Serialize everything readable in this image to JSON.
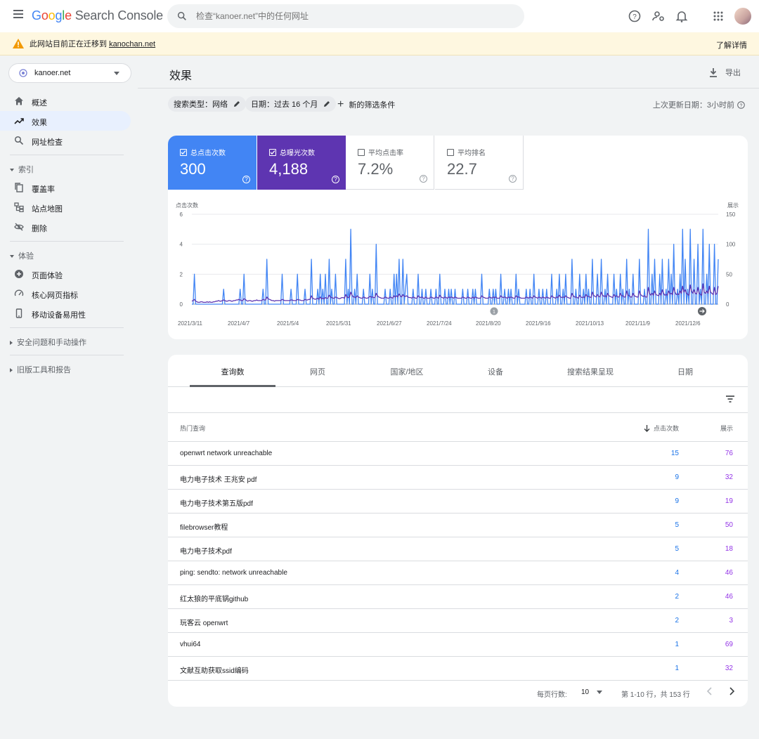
{
  "app": {
    "title_parts": [
      "G",
      "o",
      "o",
      "g",
      "l",
      "e"
    ],
    "product": "Search Console"
  },
  "search": {
    "placeholder": "检查“kanoer.net”中的任何网址"
  },
  "banner": {
    "message": "此网站目前正在迁移到 ",
    "link": "kanochan.net",
    "action": "了解详情"
  },
  "property": {
    "name": "kanoer.net"
  },
  "sidebar": {
    "items": [
      {
        "label": "概述",
        "icon": "home-icon"
      },
      {
        "label": "效果",
        "icon": "trending-up-icon"
      },
      {
        "label": "网址检查",
        "icon": "search-icon"
      }
    ],
    "sections": [
      {
        "label": "索引",
        "items": [
          {
            "label": "覆盖率",
            "icon": "copy-icon"
          },
          {
            "label": "站点地图",
            "icon": "sitemap-icon"
          },
          {
            "label": "删除",
            "icon": "eye-off-icon"
          }
        ]
      },
      {
        "label": "体验",
        "items": [
          {
            "label": "页面体验",
            "icon": "plus-circle-icon"
          },
          {
            "label": "核心网页指标",
            "icon": "gauge-icon"
          },
          {
            "label": "移动设备易用性",
            "icon": "phone-icon"
          }
        ]
      },
      {
        "label": "安全问题和手动操作"
      },
      {
        "label": "旧版工具和报告"
      }
    ]
  },
  "header": {
    "title": "效果",
    "export_label": "导出"
  },
  "filters": {
    "search_type": "搜索类型：网络",
    "date": "日期：过去 16 个月",
    "add": "新的筛选条件",
    "updated": "上次更新日期：3小时前"
  },
  "metrics": [
    {
      "label": "总点击次数",
      "value": "300",
      "checked": true,
      "color": "#4285f4"
    },
    {
      "label": "总曝光次数",
      "value": "4,188",
      "checked": true,
      "color": "#5e35b1"
    },
    {
      "label": "平均点击率",
      "value": "7.2%",
      "checked": false,
      "color": "#ffffff"
    },
    {
      "label": "平均排名",
      "value": "22.7",
      "checked": false,
      "color": "#ffffff"
    }
  ],
  "chart_data": {
    "type": "line",
    "left_axis_label": "点击次数",
    "right_axis_label": "展示",
    "left_ticks": [
      0,
      2,
      4,
      6
    ],
    "right_ticks": [
      0,
      50,
      100,
      150
    ],
    "ylim_left": [
      0,
      6
    ],
    "ylim_right": [
      0,
      150
    ],
    "x_labels": [
      "2021/3/11",
      "2021/4/7",
      "2021/5/4",
      "2021/5/31",
      "2021/6/27",
      "2021/7/24",
      "2021/8/20",
      "2021/9/16",
      "2021/10/13",
      "2021/11/9",
      "2021/12/6"
    ],
    "annotations": [
      "1"
    ],
    "series": [
      {
        "name": "点击次数",
        "color": "#4285f4",
        "axis": "left",
        "values": [
          0,
          0,
          2,
          0,
          0,
          0,
          0,
          0,
          0,
          0,
          0,
          0,
          0,
          0,
          0,
          0,
          0,
          0,
          0,
          0,
          0,
          0,
          0,
          0,
          0,
          1,
          0,
          0,
          0,
          0,
          0,
          0,
          0,
          0,
          0,
          0,
          0,
          0,
          1,
          0,
          0,
          2,
          0,
          0,
          0,
          0,
          0,
          0,
          0,
          0,
          0,
          0,
          0,
          0,
          0,
          0,
          1,
          0,
          0,
          3,
          0,
          0,
          0,
          0,
          0,
          0,
          0,
          0,
          0,
          0,
          0,
          2,
          0,
          0,
          0,
          0,
          0,
          0,
          1,
          0,
          0,
          0,
          0,
          2,
          0,
          0,
          0,
          0,
          0,
          1,
          0,
          0,
          0,
          0,
          3,
          0,
          0,
          0,
          0,
          1,
          0,
          2,
          0,
          1,
          0,
          2,
          0,
          0,
          3,
          0,
          1,
          0,
          0,
          2,
          0,
          0,
          0,
          0,
          0,
          0,
          0,
          3,
          0,
          1,
          0,
          5,
          0,
          0,
          1,
          0,
          2,
          0,
          0,
          0,
          0,
          1,
          0,
          0,
          0,
          0,
          2,
          0,
          1,
          0,
          0,
          4,
          0,
          0,
          0,
          0,
          0,
          0,
          1,
          0,
          0,
          0,
          1,
          0,
          0,
          2,
          0,
          2,
          0,
          3,
          0,
          0,
          3,
          0,
          1,
          2,
          0,
          0,
          0,
          0,
          1,
          0,
          0,
          0,
          2,
          0,
          0,
          1,
          0,
          0,
          1,
          0,
          0,
          0,
          1,
          0,
          0,
          0,
          1,
          0,
          0,
          2,
          0,
          0,
          0,
          1,
          0,
          0,
          1,
          0,
          1,
          0,
          0,
          1,
          0,
          0,
          0,
          0,
          0,
          1,
          0,
          0,
          0,
          1,
          0,
          0,
          0,
          1,
          0,
          1,
          0,
          0,
          0,
          0,
          2,
          0,
          0,
          0,
          0,
          0,
          1,
          0,
          0,
          1,
          0,
          1,
          0,
          0,
          0,
          2,
          0,
          0,
          1,
          0,
          0,
          1,
          0,
          1,
          0,
          0,
          0,
          2,
          0,
          1,
          0,
          0,
          0,
          0,
          0,
          1,
          0,
          0,
          1,
          0,
          0,
          2,
          0,
          0,
          0,
          1,
          0,
          0,
          1,
          0,
          0,
          1,
          0,
          0,
          0,
          2,
          0,
          0,
          0,
          1,
          0,
          2,
          0,
          0,
          1,
          0,
          2,
          0,
          0,
          0,
          0,
          3,
          0,
          0,
          1,
          0,
          0,
          2,
          0,
          0,
          1,
          0,
          2,
          0,
          1,
          0,
          0,
          3,
          0,
          0,
          0,
          2,
          0,
          0,
          3,
          0,
          0,
          1,
          0,
          2,
          0,
          0,
          0,
          0,
          2,
          0,
          1,
          0,
          0,
          2,
          0,
          1,
          0,
          0,
          3,
          0,
          1,
          0,
          0,
          2,
          0,
          0,
          0,
          0,
          3,
          0,
          0,
          0,
          1,
          0,
          0,
          5,
          0,
          0,
          2,
          0,
          3,
          0,
          0,
          0,
          2,
          0,
          3,
          0,
          0,
          1,
          0,
          3,
          0,
          2,
          0,
          4,
          0,
          0,
          1,
          0,
          2,
          0,
          5,
          0,
          3,
          0,
          1,
          0,
          5,
          0,
          0,
          3,
          0,
          0,
          4,
          0,
          1,
          0,
          5,
          0,
          0,
          2,
          0,
          4,
          0,
          0,
          0,
          4,
          0,
          0,
          3
        ]
      },
      {
        "name": "展示",
        "color": "#5e35b1",
        "axis": "right",
        "values": [
          5,
          6,
          8,
          5,
          4,
          3,
          3,
          4,
          4,
          3,
          3,
          3,
          4,
          3,
          4,
          3,
          3,
          4,
          4,
          5,
          5,
          6,
          5,
          5,
          6,
          7,
          6,
          5,
          5,
          6,
          6,
          5,
          5,
          6,
          6,
          7,
          7,
          8,
          7,
          6,
          6,
          9,
          8,
          6,
          5,
          6,
          6,
          5,
          5,
          6,
          6,
          7,
          6,
          6,
          6,
          6,
          8,
          7,
          7,
          12,
          9,
          8,
          7,
          6,
          6,
          5,
          6,
          6,
          6,
          6,
          6,
          8,
          7,
          6,
          6,
          6,
          6,
          6,
          7,
          7,
          6,
          6,
          6,
          8,
          7,
          7,
          6,
          6,
          6,
          8,
          7,
          7,
          8,
          8,
          14,
          10,
          9,
          8,
          9,
          10,
          8,
          12,
          9,
          10,
          9,
          11,
          10,
          10,
          15,
          12,
          11,
          10,
          10,
          12,
          11,
          10,
          9,
          10,
          11,
          11,
          10,
          16,
          12,
          11,
          12,
          20,
          15,
          12,
          12,
          11,
          14,
          12,
          11,
          10,
          10,
          12,
          11,
          10,
          10,
          11,
          13,
          12,
          12,
          11,
          11,
          18,
          14,
          12,
          11,
          10,
          10,
          10,
          12,
          11,
          10,
          10,
          12,
          11,
          10,
          14,
          12,
          14,
          12,
          17,
          14,
          12,
          16,
          13,
          13,
          14,
          12,
          11,
          11,
          10,
          12,
          11,
          10,
          10,
          14,
          12,
          11,
          12,
          10,
          10,
          12,
          10,
          10,
          10,
          12,
          11,
          10,
          10,
          12,
          11,
          10,
          15,
          12,
          11,
          10,
          12,
          11,
          10,
          12,
          11,
          12,
          11,
          10,
          12,
          11,
          10,
          10,
          10,
          10,
          12,
          11,
          10,
          10,
          12,
          11,
          10,
          10,
          12,
          10,
          12,
          11,
          10,
          10,
          10,
          14,
          12,
          11,
          10,
          10,
          10,
          12,
          11,
          10,
          12,
          11,
          12,
          10,
          10,
          10,
          14,
          12,
          11,
          12,
          11,
          10,
          12,
          11,
          12,
          11,
          10,
          10,
          14,
          12,
          12,
          11,
          10,
          10,
          10,
          10,
          12,
          11,
          10,
          12,
          11,
          10,
          14,
          12,
          11,
          10,
          12,
          11,
          10,
          12,
          11,
          10,
          12,
          11,
          10,
          10,
          14,
          12,
          11,
          10,
          12,
          11,
          15,
          12,
          11,
          12,
          11,
          14,
          12,
          11,
          10,
          10,
          18,
          14,
          12,
          12,
          11,
          10,
          15,
          12,
          11,
          12,
          11,
          16,
          13,
          13,
          12,
          11,
          20,
          15,
          13,
          12,
          16,
          13,
          12,
          20,
          15,
          13,
          14,
          12,
          18,
          14,
          13,
          12,
          11,
          16,
          13,
          14,
          12,
          12,
          18,
          14,
          14,
          12,
          12,
          22,
          15,
          14,
          12,
          12,
          18,
          14,
          13,
          12,
          12,
          22,
          16,
          14,
          13,
          14,
          12,
          12,
          28,
          18,
          15,
          18,
          15,
          22,
          16,
          15,
          14,
          18,
          15,
          24,
          18,
          15,
          16,
          15,
          22,
          17,
          18,
          16,
          28,
          20,
          16,
          17,
          16,
          22,
          18,
          30,
          20,
          24,
          18,
          16,
          15,
          32,
          22,
          18,
          24,
          18,
          17,
          28,
          18,
          16,
          15,
          34,
          20,
          18,
          22,
          18,
          30,
          20,
          18,
          16,
          28,
          16,
          18,
          30
        ]
      }
    ]
  },
  "tabs": [
    "查询数",
    "网页",
    "国家/地区",
    "设备",
    "搜索结果呈现",
    "日期"
  ],
  "table": {
    "headers": {
      "query": "热门查询",
      "clicks": "点击次数",
      "impressions": "展示"
    },
    "rows": [
      {
        "query": "openwrt network unreachable",
        "clicks": "15",
        "impressions": "76"
      },
      {
        "query": "电力电子技术 王兆安 pdf",
        "clicks": "9",
        "impressions": "32"
      },
      {
        "query": "电力电子技术第五版pdf",
        "clicks": "9",
        "impressions": "19"
      },
      {
        "query": "filebrowser教程",
        "clicks": "5",
        "impressions": "50"
      },
      {
        "query": "电力电子技术pdf",
        "clicks": "5",
        "impressions": "18"
      },
      {
        "query": "ping: sendto: network unreachable",
        "clicks": "4",
        "impressions": "46"
      },
      {
        "query": "红太狼的平底锅github",
        "clicks": "2",
        "impressions": "46"
      },
      {
        "query": "玩客云 openwrt",
        "clicks": "2",
        "impressions": "3"
      },
      {
        "query": "vhui64",
        "clicks": "1",
        "impressions": "69"
      },
      {
        "query": "文献互助获取ssid编码",
        "clicks": "1",
        "impressions": "32"
      }
    ]
  },
  "pager": {
    "rows_label": "每页行数:",
    "rows_value": "10",
    "range": "第 1-10 行，共 153 行"
  }
}
